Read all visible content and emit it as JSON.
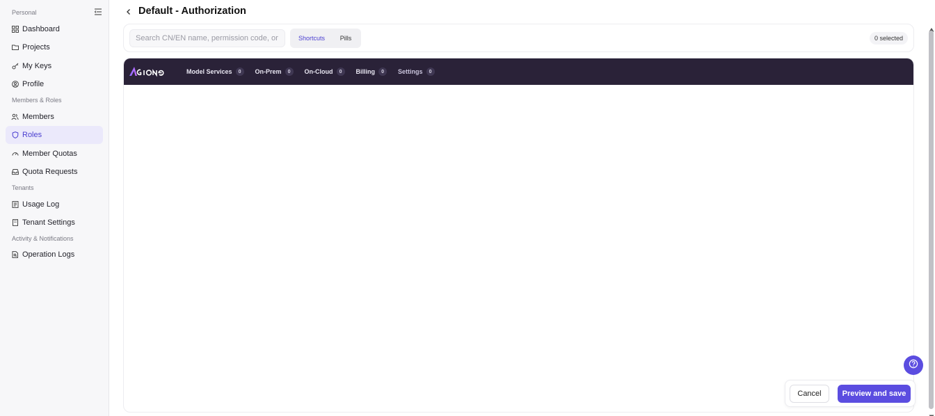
{
  "sidebar": {
    "sections": [
      {
        "label": "Personal"
      },
      {
        "label": "Members & Roles"
      },
      {
        "label": "Tenants"
      },
      {
        "label": "Activity & Notifications"
      }
    ],
    "items": [
      {
        "label": "Dashboard",
        "icon": "dashboard-icon"
      },
      {
        "label": "Projects",
        "icon": "folder-icon"
      },
      {
        "label": "My Keys",
        "icon": "key-icon"
      },
      {
        "label": "Profile",
        "icon": "user-circle-icon"
      },
      {
        "label": "Members",
        "icon": "users-icon"
      },
      {
        "label": "Roles",
        "icon": "shield-icon",
        "active": true
      },
      {
        "label": "Member Quotas",
        "icon": "gauge-icon"
      },
      {
        "label": "Quota Requests",
        "icon": "inbox-icon"
      },
      {
        "label": "Usage Log",
        "icon": "log-icon"
      },
      {
        "label": "Tenant Settings",
        "icon": "building-icon"
      },
      {
        "label": "Operation Logs",
        "icon": "file-search-icon"
      }
    ]
  },
  "header": {
    "title": "Default - Authorization"
  },
  "toolbar": {
    "search_placeholder": "Search CN/EN name, permission code, or path",
    "view_modes": [
      "Shortcuts",
      "Pills"
    ],
    "active_view": "Shortcuts",
    "selected_label": "0 selected"
  },
  "permission_tabs": [
    {
      "label": "Model Services",
      "count": "0"
    },
    {
      "label": "On-Prem",
      "count": "0"
    },
    {
      "label": "On-Cloud",
      "count": "0"
    },
    {
      "label": "Billing",
      "count": "0"
    },
    {
      "label": "Settings",
      "count": "0"
    }
  ],
  "actions": {
    "cancel_label": "Cancel",
    "save_label": "Preview and save"
  },
  "colors": {
    "accent": "#5b4de0",
    "topbar": "#2a2238",
    "active_nav_bg": "#ebe9fb"
  }
}
